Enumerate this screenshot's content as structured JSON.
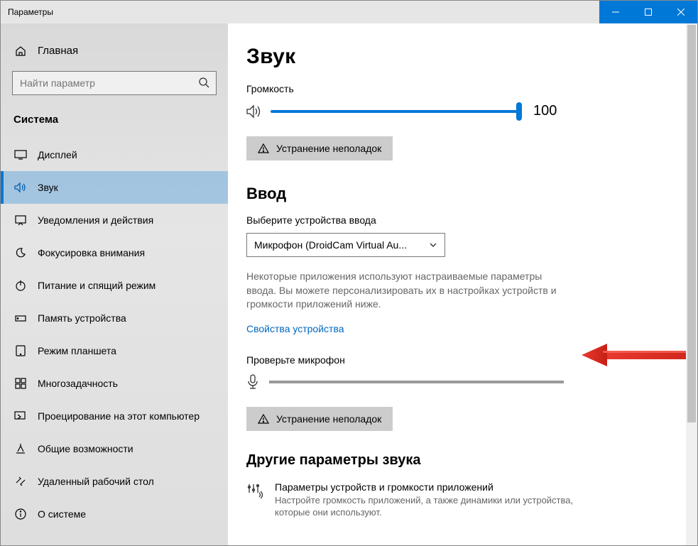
{
  "window": {
    "title": "Параметры"
  },
  "sidebar": {
    "home_label": "Главная",
    "search_placeholder": "Найти параметр",
    "section_label": "Система",
    "items": [
      {
        "label": "Дисплей"
      },
      {
        "label": "Звук"
      },
      {
        "label": "Уведомления и действия"
      },
      {
        "label": "Фокусировка внимания"
      },
      {
        "label": "Питание и спящий режим"
      },
      {
        "label": "Память устройства"
      },
      {
        "label": "Режим планшета"
      },
      {
        "label": "Многозадачность"
      },
      {
        "label": "Проецирование на этот компьютер"
      },
      {
        "label": "Общие возможности"
      },
      {
        "label": "Удаленный рабочий стол"
      },
      {
        "label": "О системе"
      }
    ]
  },
  "main": {
    "title": "Звук",
    "volume": {
      "label": "Громкость",
      "value": "100"
    },
    "troubleshoot_out": "Устранение неполадок",
    "input": {
      "heading": "Ввод",
      "choose_label": "Выберите устройства ввода",
      "selected": "Микрофон (DroidCam Virtual Au...",
      "desc": "Некоторые приложения используют настраиваемые параметры ввода. Вы можете персонализировать их в настройках устройств и громкости приложений ниже.",
      "props_link": "Свойства устройства",
      "test_label": "Проверьте микрофон",
      "troubleshoot_in": "Устранение неполадок"
    },
    "other": {
      "heading": "Другие параметры звука",
      "opt_title": "Параметры устройств и громкости приложений",
      "opt_desc": "Настройте громкость приложений, а также динамики или устройства, которые они используют."
    }
  }
}
